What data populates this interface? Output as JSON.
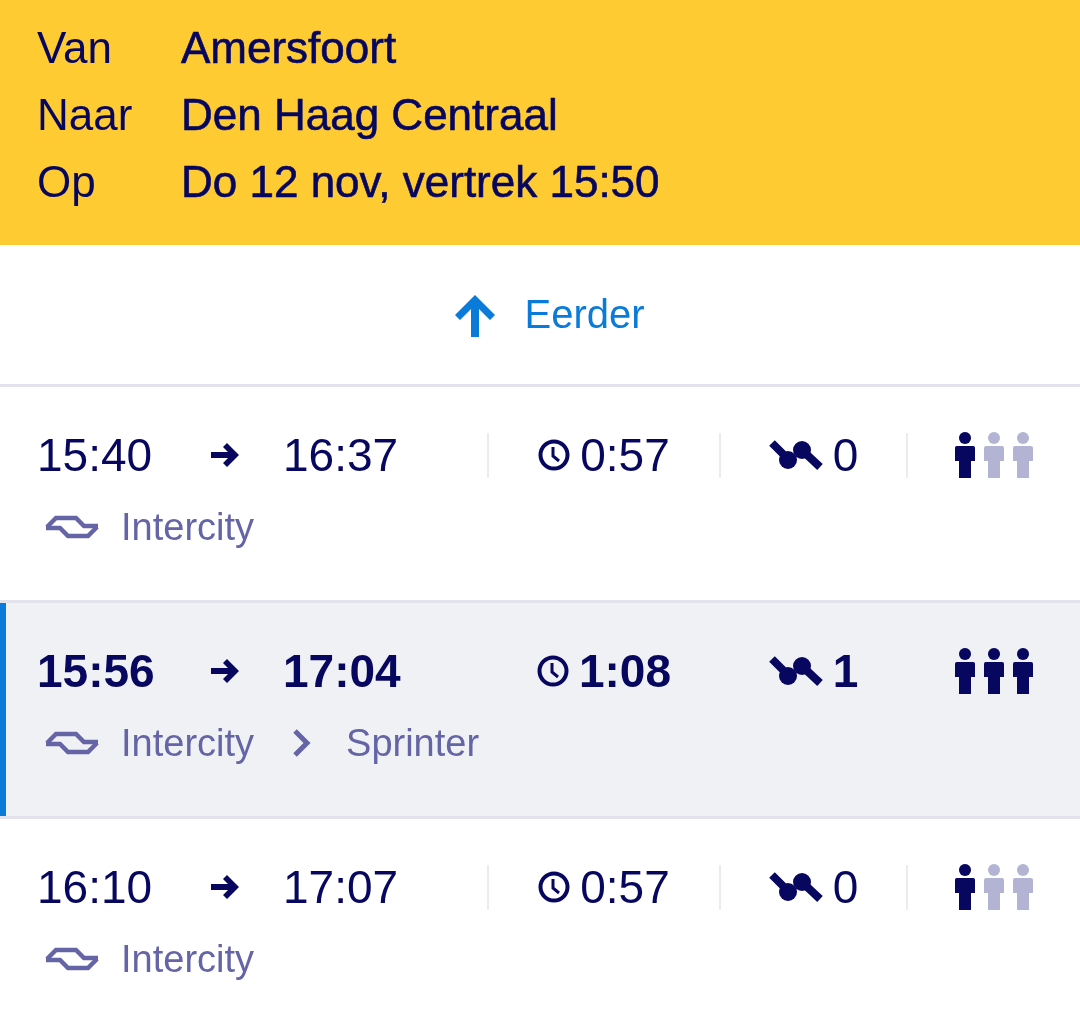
{
  "trip_query": [
    {
      "label": "Van",
      "value": "Amersfoort"
    },
    {
      "label": "Naar",
      "value": "Den Haag Centraal"
    },
    {
      "label": "Op",
      "value": "Do 12 nov, vertrek 15:50"
    }
  ],
  "earlier_button": {
    "label": "Eerder"
  },
  "trips": [
    {
      "departure": "15:40",
      "arrival": "16:37",
      "duration": "0:57",
      "transfers": "0",
      "crowding": {
        "level": 0.33
      },
      "selected": false,
      "legs": [
        "Intercity"
      ]
    },
    {
      "departure": "15:56",
      "arrival": "17:04",
      "duration": "1:08",
      "transfers": "1",
      "crowding": {
        "level": 1
      },
      "selected": true,
      "legs": [
        "Intercity",
        "Sprinter"
      ]
    },
    {
      "departure": "16:10",
      "arrival": "17:07",
      "duration": "0:57",
      "transfers": "0",
      "crowding": {
        "level": 0.33
      },
      "selected": false,
      "legs": [
        "Intercity"
      ]
    }
  ]
}
